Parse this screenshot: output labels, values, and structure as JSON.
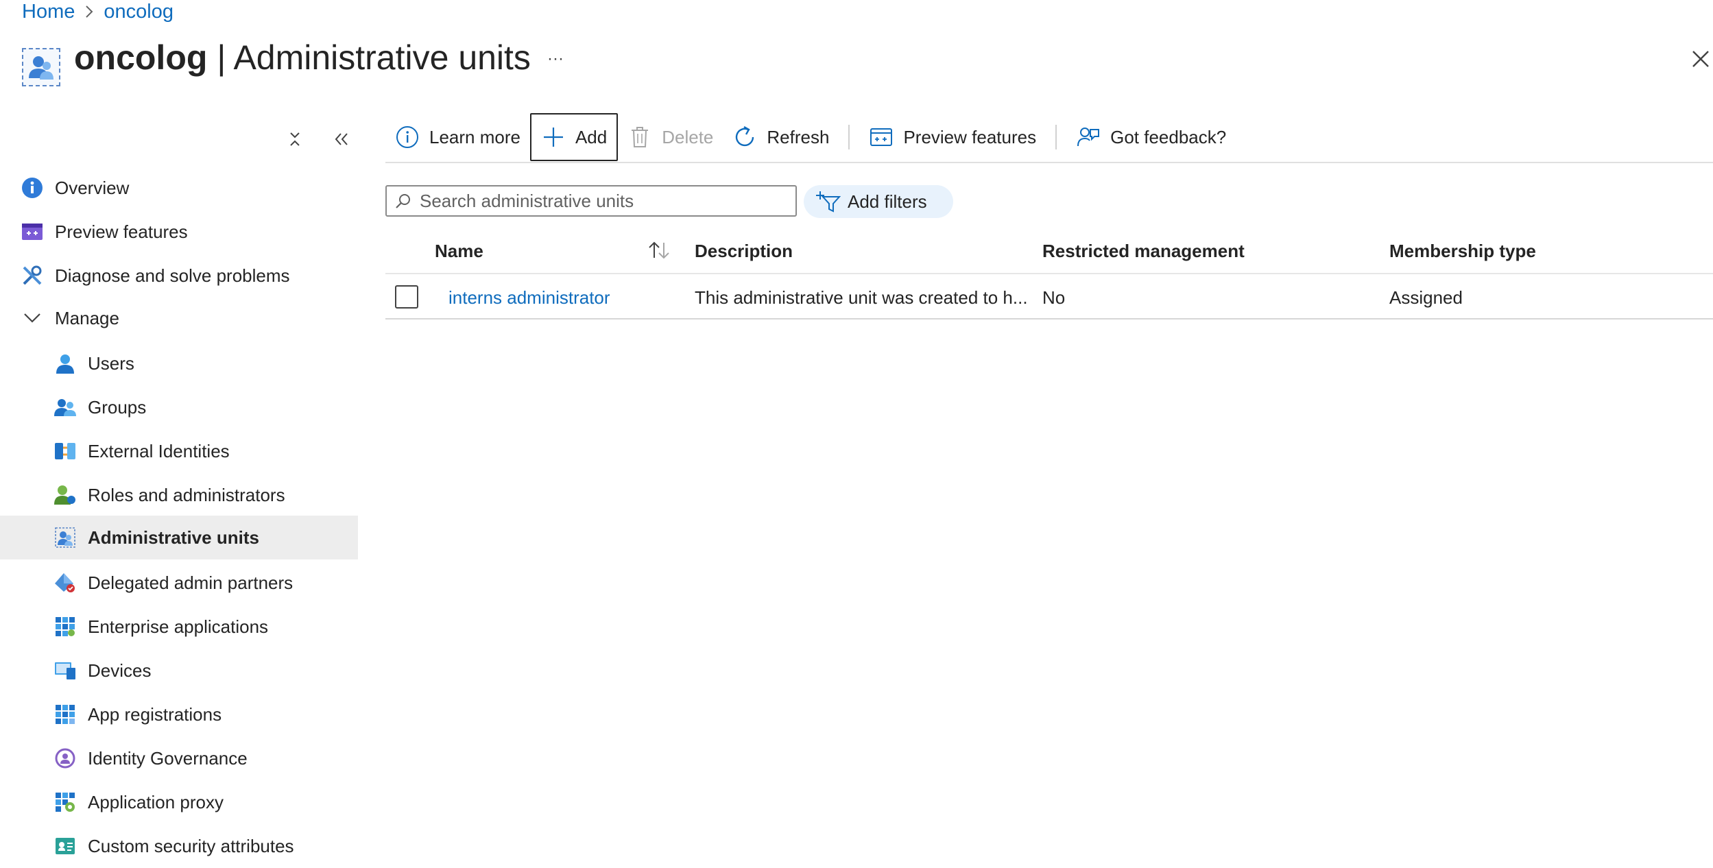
{
  "breadcrumb": {
    "home": "Home",
    "current": "oncolog"
  },
  "header": {
    "org": "oncolog",
    "separator": " | ",
    "page": "Administrative units",
    "more": "···"
  },
  "sidebar": {
    "items": [
      {
        "label": "Overview",
        "icon": "info-icon"
      },
      {
        "label": "Preview features",
        "icon": "preview-icon"
      },
      {
        "label": "Diagnose and solve problems",
        "icon": "wrench-icon"
      },
      {
        "label": "Manage",
        "icon": "chevron-down-icon"
      },
      {
        "label": "Users",
        "icon": "user-icon"
      },
      {
        "label": "Groups",
        "icon": "groups-icon"
      },
      {
        "label": "External Identities",
        "icon": "external-identities-icon"
      },
      {
        "label": "Roles and administrators",
        "icon": "roles-icon"
      },
      {
        "label": "Administrative units",
        "icon": "admin-units-icon"
      },
      {
        "label": "Delegated admin partners",
        "icon": "delegated-admin-icon"
      },
      {
        "label": "Enterprise applications",
        "icon": "enterprise-apps-icon"
      },
      {
        "label": "Devices",
        "icon": "devices-icon"
      },
      {
        "label": "App registrations",
        "icon": "app-registrations-icon"
      },
      {
        "label": "Identity Governance",
        "icon": "identity-governance-icon"
      },
      {
        "label": "Application proxy",
        "icon": "application-proxy-icon"
      },
      {
        "label": "Custom security attributes",
        "icon": "security-attributes-icon"
      }
    ]
  },
  "toolbar": {
    "learn_more": "Learn more",
    "add": "Add",
    "delete": "Delete",
    "refresh": "Refresh",
    "preview_features": "Preview features",
    "feedback": "Got feedback?"
  },
  "search": {
    "placeholder": "Search administrative units",
    "value": ""
  },
  "filters": {
    "label": "Add filters"
  },
  "table": {
    "columns": [
      "Name",
      "Description",
      "Restricted management",
      "Membership type"
    ],
    "rows": [
      {
        "name": "interns administrator",
        "description": "This administrative unit was created to h...",
        "restricted": "No",
        "membership": "Assigned"
      }
    ]
  },
  "colors": {
    "link": "#0f6cbd",
    "active_bg": "#ededed",
    "filter_bg": "#e8f2fc"
  }
}
